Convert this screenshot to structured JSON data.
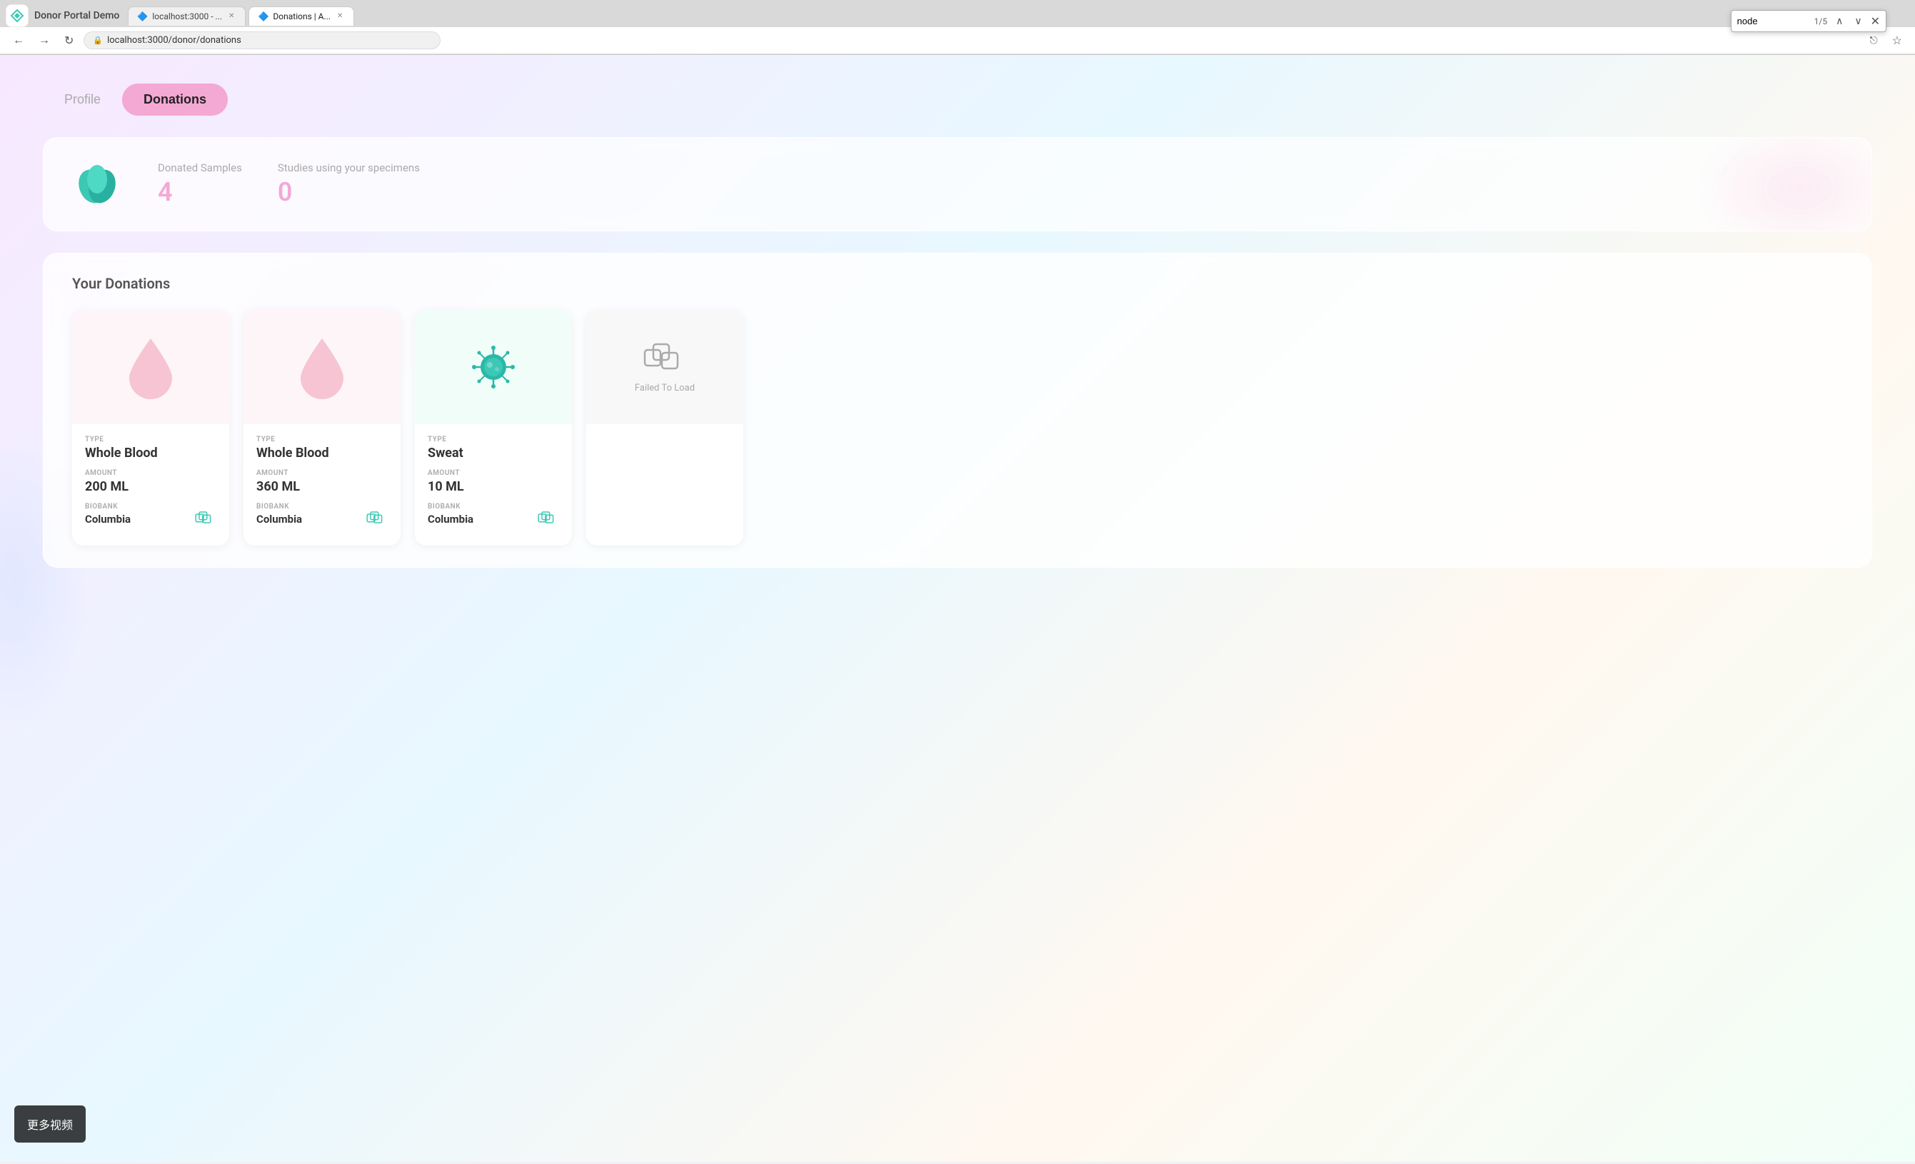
{
  "browser": {
    "tabs": [
      {
        "id": "tab1",
        "label": "localhost:3000 - ...",
        "active": false,
        "favicon": "🔷"
      },
      {
        "id": "tab2",
        "label": "Donations | A...",
        "active": true,
        "favicon": "🔷"
      }
    ],
    "url": "localhost:3000/donor/donations",
    "url_icon": "🔒",
    "find_bar": {
      "query": "node",
      "count": "1/5"
    }
  },
  "app": {
    "title": "Donor Portal Demo"
  },
  "nav": {
    "tabs": [
      {
        "id": "profile",
        "label": "Profile",
        "active": false
      },
      {
        "id": "donations",
        "label": "Donations",
        "active": true
      }
    ]
  },
  "stats": {
    "donated_samples_label": "Donated Samples",
    "donated_samples_value": "4",
    "studies_label": "Studies using your specimens",
    "studies_value": "0"
  },
  "donations_section": {
    "title": "Your Donations",
    "cards": [
      {
        "id": "card1",
        "visual_type": "blood",
        "type_label": "TYPE",
        "type_value": "Whole Blood",
        "amount_label": "AMOUNT",
        "amount_value": "200 ML",
        "biobank_label": "BIOBANK",
        "biobank_value": "Columbia"
      },
      {
        "id": "card2",
        "visual_type": "blood",
        "type_label": "TYPE",
        "type_value": "Whole Blood",
        "amount_label": "AMOUNT",
        "amount_value": "360 ML",
        "biobank_label": "BIOBANK",
        "biobank_value": "Columbia"
      },
      {
        "id": "card3",
        "visual_type": "virus",
        "type_label": "TYPE",
        "type_value": "Sweat",
        "amount_label": "AMOUNT",
        "amount_value": "10 ML",
        "biobank_label": "BIOBANK",
        "biobank_value": "Columbia"
      },
      {
        "id": "card4",
        "visual_type": "failed",
        "failed_text": "Failed To Load",
        "type_label": "",
        "type_value": "",
        "amount_label": "",
        "amount_value": "",
        "biobank_label": "",
        "biobank_value": ""
      }
    ]
  },
  "overlay": {
    "label": "更多视频"
  },
  "colors": {
    "accent_pink": "#f4a8d4",
    "teal": "#3cc8b4",
    "card_bg": "#fff",
    "text_primary": "#333",
    "text_secondary": "#aaa"
  }
}
